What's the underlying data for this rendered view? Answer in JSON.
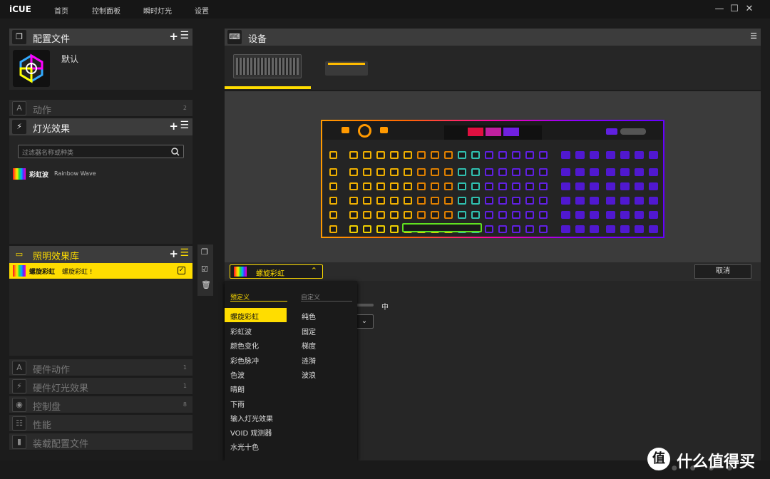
{
  "app": {
    "logo": "iCUE",
    "nav": [
      "首页",
      "控制面板",
      "瞬时灯光",
      "设置"
    ]
  },
  "window": {
    "minimize": "—",
    "maximize": "☐",
    "close": "✕"
  },
  "profiles": {
    "title": "配置文件",
    "default_name": "默认"
  },
  "actions": {
    "title": "动作",
    "count": "2"
  },
  "lighting": {
    "title": "灯光效果",
    "filter_placeholder": "过滤器名称或种类",
    "item_name": "彩虹波",
    "item_sub": "Rainbow Wave"
  },
  "library": {
    "title": "照明效果库",
    "item_name": "螺旋彩虹",
    "item_sub": "螺旋彩虹 !"
  },
  "hardware": [
    {
      "title": "硬件动作",
      "count": "1"
    },
    {
      "title": "硬件灯光效果",
      "count": "1"
    },
    {
      "title": "控制盘",
      "count": "8"
    },
    {
      "title": "性能",
      "count": ""
    },
    {
      "title": "装载配置文件",
      "count": ""
    }
  ],
  "devices": {
    "title": "设备"
  },
  "effect_bar": {
    "selected": "螺旋彩虹",
    "cancel": "取消",
    "speed_label": "中"
  },
  "dropdown": {
    "predefined_header": "预定义",
    "custom_header": "自定义",
    "predefined": [
      "螺旋彩虹",
      "彩虹波",
      "颜色变化",
      "彩色脉冲",
      "色波",
      "晴朗",
      "下雨",
      "输入灯光效果",
      "VOID 观测器",
      "水光十色"
    ],
    "custom": [
      "纯色",
      "固定",
      "梯度",
      "涟漪",
      "波浪"
    ]
  },
  "watermark": {
    "text": "什么值得买"
  }
}
